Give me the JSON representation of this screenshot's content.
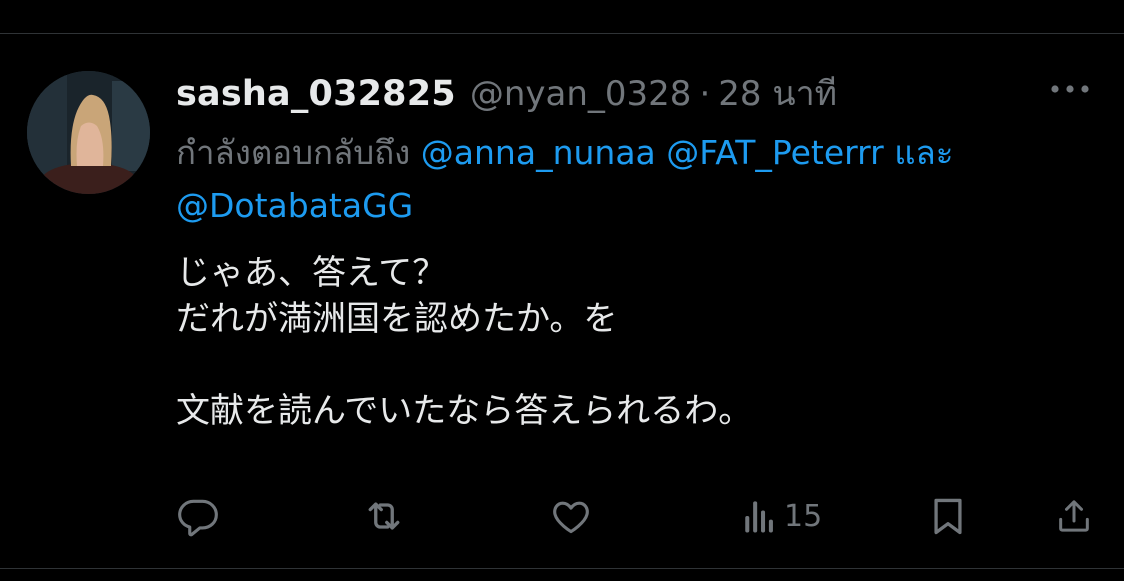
{
  "post": {
    "display_name": "sasha_032825",
    "handle": "@nyan_0328",
    "separator": "·",
    "timestamp": "28 นาที",
    "reply_prefix": "กำลังตอบกลับถึง",
    "reply_mentions": [
      "@anna_nunaa",
      "@FAT_Peterrr"
    ],
    "reply_conjunction": "และ",
    "reply_last_mention": "@DotabataGG",
    "text_lines": [
      "じゃあ、答えて？",
      "だれが満洲国を認めたか。を",
      "",
      "文献を読んでいたなら答えられるわ。"
    ]
  },
  "actions": {
    "reply_icon": "reply-icon",
    "repost_icon": "repost-icon",
    "like_icon": "heart-icon",
    "views_icon": "views-chart-icon",
    "views_count": "15",
    "bookmark_icon": "bookmark-icon",
    "share_icon": "share-icon"
  },
  "colors": {
    "background": "#000000",
    "text_primary": "#e7e9ea",
    "text_secondary": "#71767b",
    "accent_link": "#1d9bf0",
    "divider": "#2f3336"
  }
}
